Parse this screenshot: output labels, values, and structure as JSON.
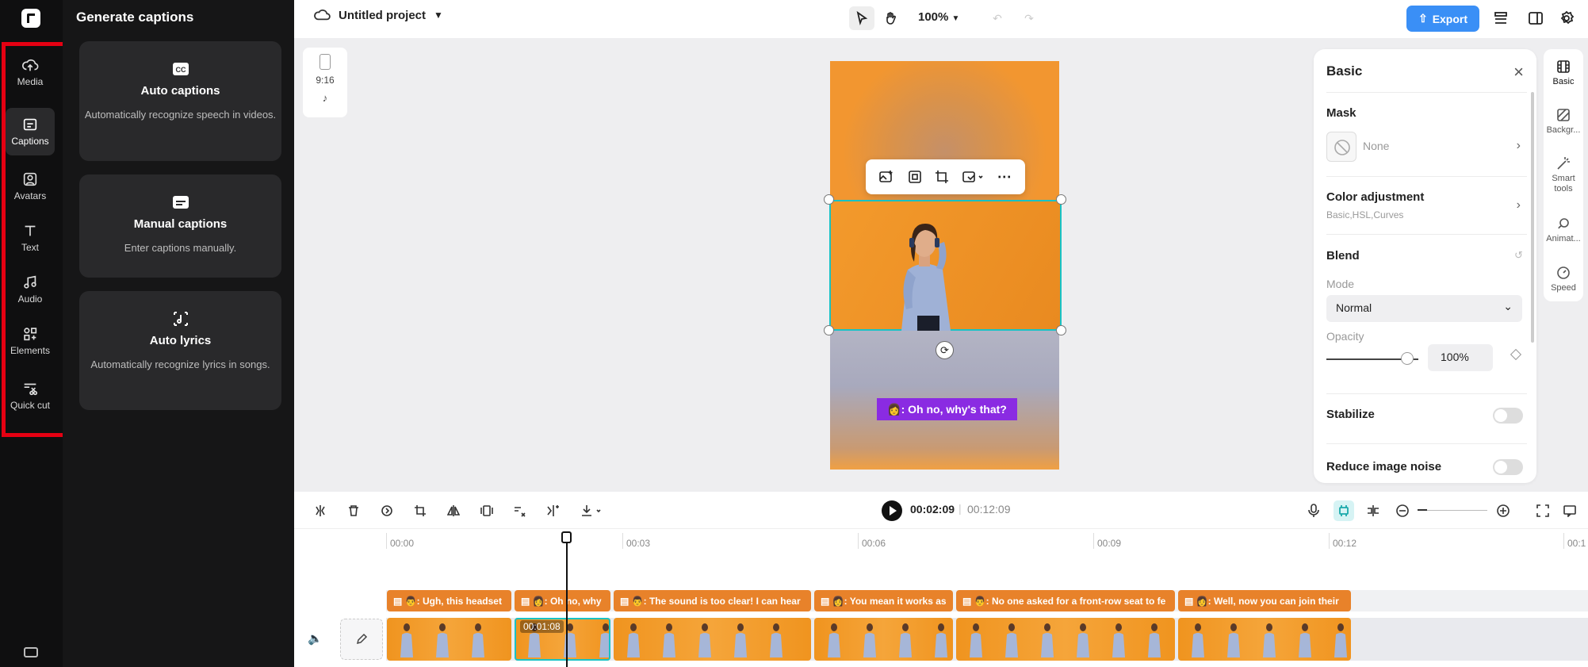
{
  "rail": {
    "items": [
      {
        "label": "Media",
        "icon": "cloud-upload-icon"
      },
      {
        "label": "Captions",
        "icon": "captions-icon"
      },
      {
        "label": "Avatars",
        "icon": "avatar-icon"
      },
      {
        "label": "Text",
        "icon": "text-icon"
      },
      {
        "label": "Audio",
        "icon": "music-icon"
      },
      {
        "label": "Elements",
        "icon": "elements-icon"
      },
      {
        "label": "Quick cut",
        "icon": "scissors-icon"
      }
    ]
  },
  "captions_panel": {
    "title": "Generate captions",
    "cards": [
      {
        "title": "Auto captions",
        "desc": "Automatically recognize speech in videos."
      },
      {
        "title": "Manual captions",
        "desc": "Enter captions manually."
      },
      {
        "title": "Auto lyrics",
        "desc": "Automatically recognize lyrics in songs."
      }
    ]
  },
  "topbar": {
    "project": "Untitled project",
    "zoom": "100%",
    "export": "Export"
  },
  "canvas": {
    "ratio": "9:16",
    "caption": "👩: Oh no, why's that?"
  },
  "props": {
    "title": "Basic",
    "mask_label": "Mask",
    "mask_value": "None",
    "color_label": "Color adjustment",
    "color_sub": "Basic,HSL,Curves",
    "blend_label": "Blend",
    "mode_label": "Mode",
    "mode_value": "Normal",
    "opacity_label": "Opacity",
    "opacity_value": "100%",
    "opacity_level": 1.0,
    "stabilize": "Stabilize",
    "noise": "Reduce image noise"
  },
  "right_tabs": [
    "Basic",
    "Backgr...",
    "Smart tools",
    "Animat...",
    "Speed"
  ],
  "timeline": {
    "current": "00:02:09",
    "total": "00:12:09",
    "ticks": [
      "00:00",
      "00:03",
      "00:06",
      "00:09",
      "00:12",
      "00:1"
    ],
    "captions": [
      "👨: Ugh, this headset",
      "👩: Oh no, why",
      "👨: The sound is too clear! I can hear",
      "👩: You mean it works as",
      "👨: No one asked for a front-row seat to fe",
      "👩: Well, now you can join their"
    ],
    "clip_time": "00:01:08"
  },
  "colors": {
    "accent": "#3a8ff6",
    "selection": "#19c2c4",
    "caption_bg": "#8a2be2",
    "highlight": "#e50012"
  }
}
